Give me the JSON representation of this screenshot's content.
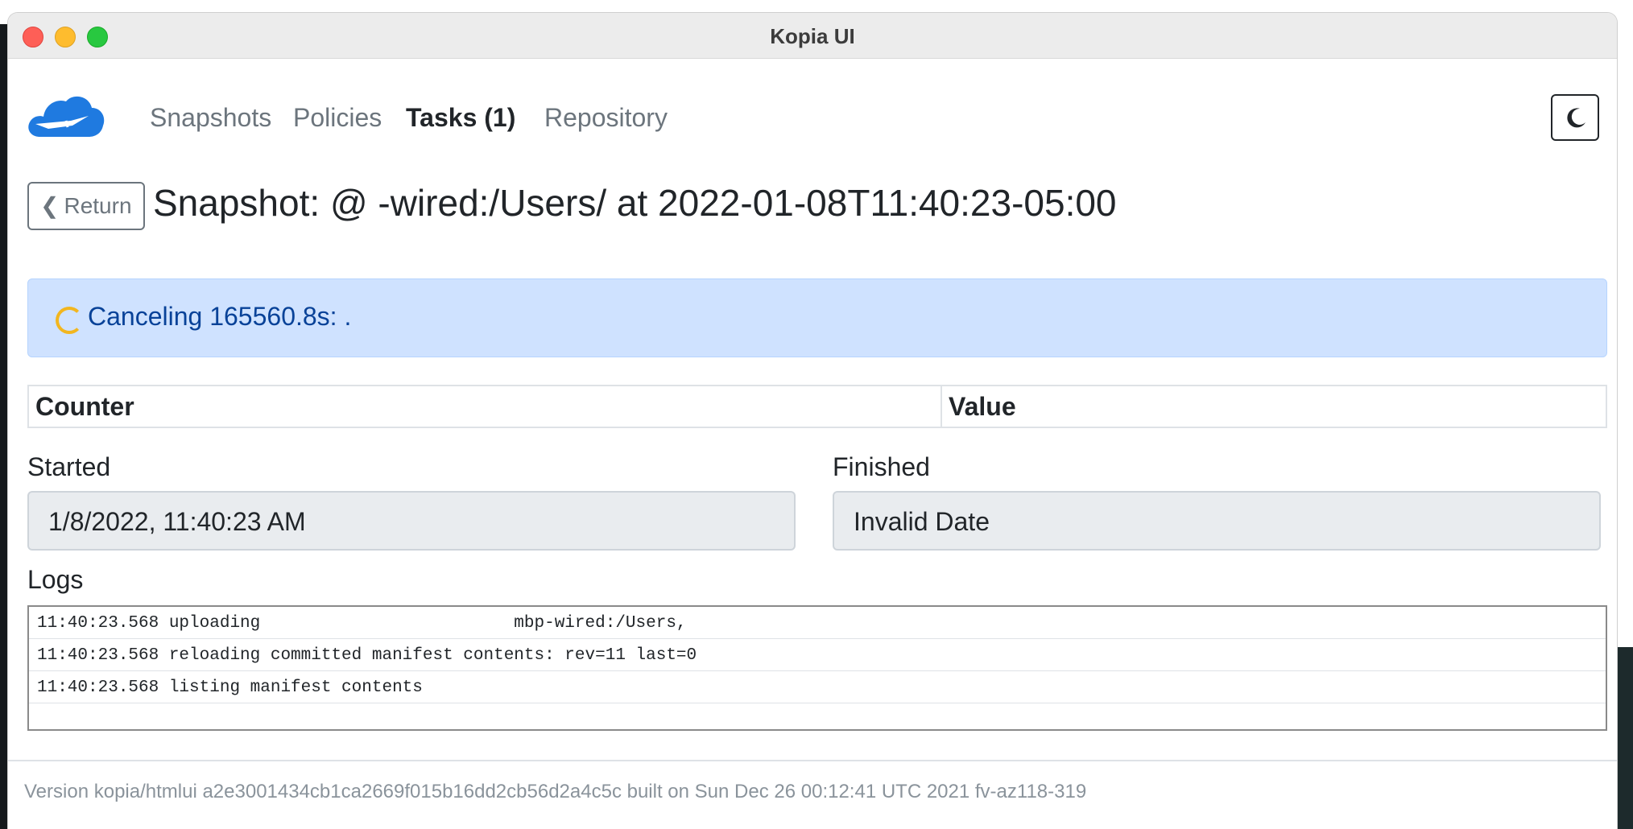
{
  "window": {
    "title": "Kopia UI"
  },
  "nav": {
    "logo_alt": "kopia-logo",
    "links": [
      "Snapshots",
      "Policies",
      "Tasks (1)",
      "Repository"
    ],
    "active_index": 2
  },
  "header": {
    "return_label": "Return",
    "title": "Snapshot:                         @                     -wired:/Users/                     at 2022-01-08T11:40:23-05:00"
  },
  "status": {
    "text": "Canceling 165560.8s: ."
  },
  "counters_table": {
    "headers": [
      "Counter",
      "Value"
    ]
  },
  "fields": {
    "started_label": "Started",
    "started_value": "1/8/2022, 11:40:23 AM",
    "finished_label": "Finished",
    "finished_value": "Invalid Date"
  },
  "logs": {
    "label": "Logs",
    "lines": [
      "11:40:23.568 uploading                         mbp-wired:/Users,",
      "11:40:23.568 reloading committed manifest contents: rev=11 last=0",
      "11:40:23.568 listing manifest contents"
    ]
  },
  "footer": {
    "version_text": "Version kopia/htmlui a2e3001434cb1ca2669f015b16dd2cb56d2a4c5c built on Sun Dec 26 00:12:41 UTC 2021 fv-az118-319"
  },
  "colors": {
    "alert_bg": "#cfe2ff",
    "alert_text": "#084298",
    "spinner": "#f2b61f",
    "logo_blue": "#1f7ae0"
  }
}
